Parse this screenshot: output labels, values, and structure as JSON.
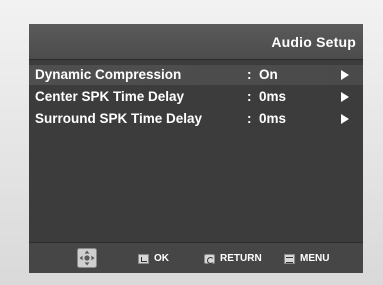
{
  "header": {
    "title": "Audio Setup"
  },
  "menu": {
    "items": [
      {
        "label": "Dynamic Compression",
        "sep": ":",
        "value": "On",
        "selected": true,
        "arrow_icon": "right-arrow-icon"
      },
      {
        "label": "Center SPK Time Delay",
        "sep": ":",
        "value": "0ms",
        "selected": false,
        "arrow_icon": "right-arrow-icon"
      },
      {
        "label": "Surround SPK Time Delay",
        "sep": ":",
        "value": "0ms",
        "selected": false,
        "arrow_icon": "right-arrow-icon"
      }
    ]
  },
  "footer": {
    "nav_icon": "directional-pad-icon",
    "ok_label": "OK",
    "return_label": "RETURN",
    "menu_label": "MENU"
  },
  "colors": {
    "screen_bg": "#3c3c3c",
    "text": "#ffffff",
    "selected_row": "#4f4f4f",
    "bezel": "#e0e0e0"
  }
}
